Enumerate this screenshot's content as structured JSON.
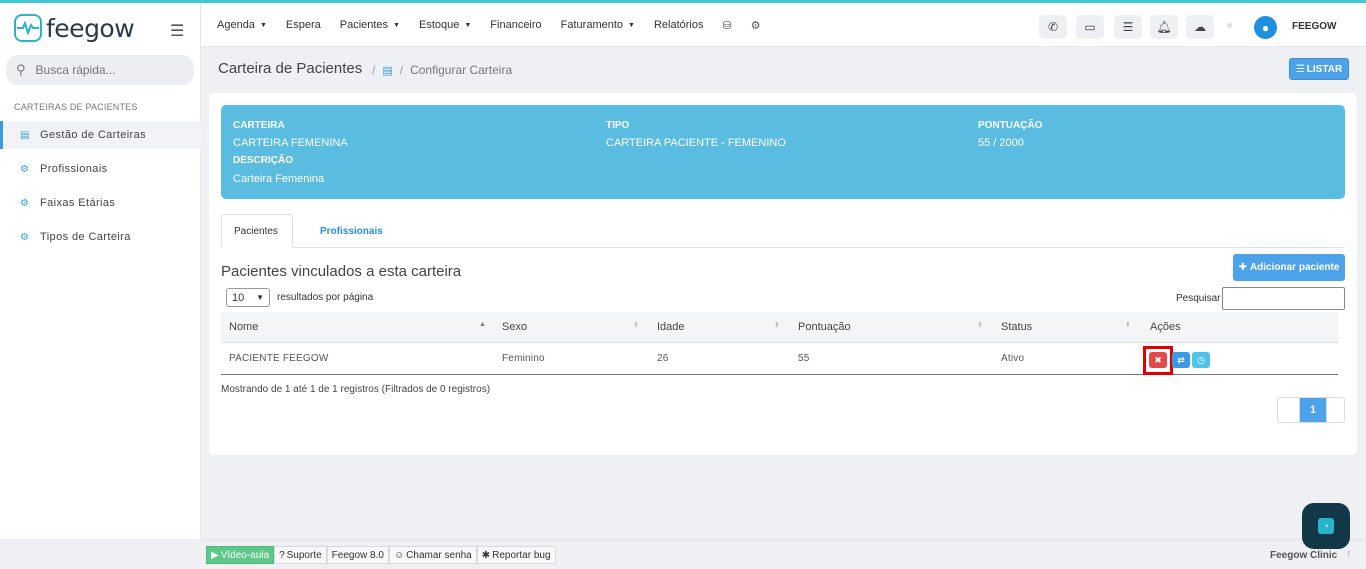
{
  "brand": {
    "logo_text": "feegow"
  },
  "sidebar": {
    "search_placeholder": "Busca rápida...",
    "heading": "CARTEIRAS DE PACIENTES",
    "items": [
      {
        "label": "Gestão de Carteiras",
        "icon": "book-icon"
      },
      {
        "label": "Profissionais",
        "icon": "gear-icon"
      },
      {
        "label": "Faixas Etárias",
        "icon": "gear-icon"
      },
      {
        "label": "Tipos de Carteira",
        "icon": "gear-icon"
      }
    ]
  },
  "header": {
    "nav": [
      {
        "label": "Agenda",
        "dropdown": true
      },
      {
        "label": "Espera",
        "dropdown": false
      },
      {
        "label": "Pacientes",
        "dropdown": true
      },
      {
        "label": "Estoque",
        "dropdown": true
      },
      {
        "label": "Financeiro",
        "dropdown": false
      },
      {
        "label": "Faturamento",
        "dropdown": true
      },
      {
        "label": "Relatórios",
        "dropdown": false
      }
    ],
    "icons": [
      "phone-icon",
      "inbox-icon",
      "checklist-icon",
      "bell-icon",
      "chat-icon"
    ],
    "user_name": "FEEGOW"
  },
  "page": {
    "title": "Carteira de Pacientes",
    "breadcrumb_current": "Configurar Carteira",
    "listar_label": "LISTAR"
  },
  "info": {
    "carteira_label": "CARTEIRA",
    "carteira_value": "CARTEIRA FEMENINA",
    "descricao_label": "DESCRIÇÃO",
    "descricao_value": "Carteira Femenina",
    "tipo_label": "TIPO",
    "tipo_value": "CARTEIRA PACIENTE - FEMENINO",
    "pontuacao_label": "PONTUAÇÃO",
    "pontuacao_value": "55 / 2000"
  },
  "tabs": [
    {
      "label": "Pacientes",
      "active": true
    },
    {
      "label": "Profissionais",
      "active": false
    }
  ],
  "section": {
    "title": "Pacientes vinculados a esta carteira",
    "add_button": "Adicionar paciente",
    "page_length": "10",
    "length_label": "resultados por página",
    "filter_label": "Pesquisar"
  },
  "table": {
    "columns": [
      "Nome",
      "Sexo",
      "Idade",
      "Pontuação",
      "Status",
      "Ações"
    ],
    "rows": [
      {
        "nome": "PACIENTE FEEGOW",
        "sexo": "Feminino",
        "idade": "26",
        "pontuacao": "55",
        "status": "Ativo"
      }
    ],
    "info": "Mostrando de 1 até 1 de 1 registros (Filtrados de 0 registros)",
    "current_page": "1"
  },
  "footer": {
    "video": "Vídeo-aula",
    "suporte": "Suporte",
    "version": "Feegow 8.0",
    "chamar": "Chamar senha",
    "bug": "Reportar bug",
    "brand": "Feegow Clinic"
  },
  "colors": {
    "accent": "#4da3ea",
    "info_panel": "#5bbce2",
    "danger": "#e24a4a",
    "highlight": "#e00000"
  }
}
